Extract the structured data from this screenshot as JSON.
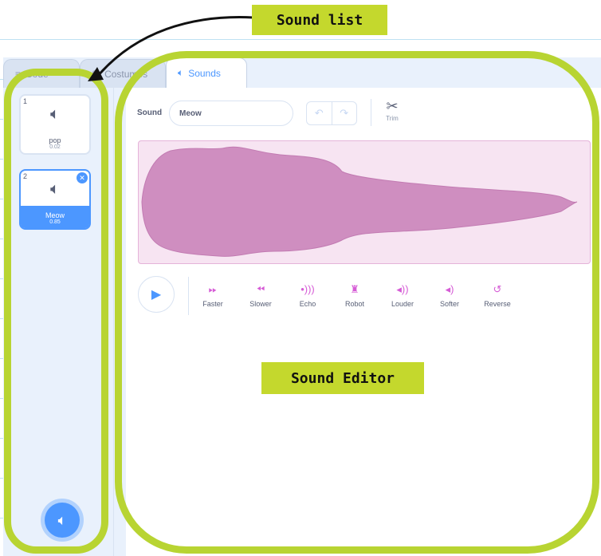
{
  "annotations": {
    "sound_list": "Sound list",
    "sound_editor": "Sound Editor"
  },
  "tabs": [
    {
      "label": "Code",
      "icon": "code-icon"
    },
    {
      "label": "Costumes",
      "icon": "costume-icon"
    },
    {
      "label": "Sounds",
      "icon": "speaker-icon"
    }
  ],
  "sound_list": [
    {
      "index": "1",
      "name": "pop",
      "duration": "0.02",
      "selected": false
    },
    {
      "index": "2",
      "name": "Meow",
      "duration": "0.85",
      "selected": true
    }
  ],
  "editor": {
    "sound_label": "Sound",
    "sound_name": "Meow",
    "trim_label": "Trim",
    "effects": [
      {
        "label": "Faster",
        "icon": "faster-icon"
      },
      {
        "label": "Slower",
        "icon": "slower-icon"
      },
      {
        "label": "Echo",
        "icon": "echo-icon"
      },
      {
        "label": "Robot",
        "icon": "robot-icon"
      },
      {
        "label": "Louder",
        "icon": "louder-icon"
      },
      {
        "label": "Softer",
        "icon": "softer-icon"
      },
      {
        "label": "Reverse",
        "icon": "reverse-icon"
      }
    ]
  },
  "colors": {
    "accent": "#4c97ff",
    "waveform": "#cf8ec0",
    "annotation": "#b8d432",
    "effect_icon": "#d65cd6"
  }
}
